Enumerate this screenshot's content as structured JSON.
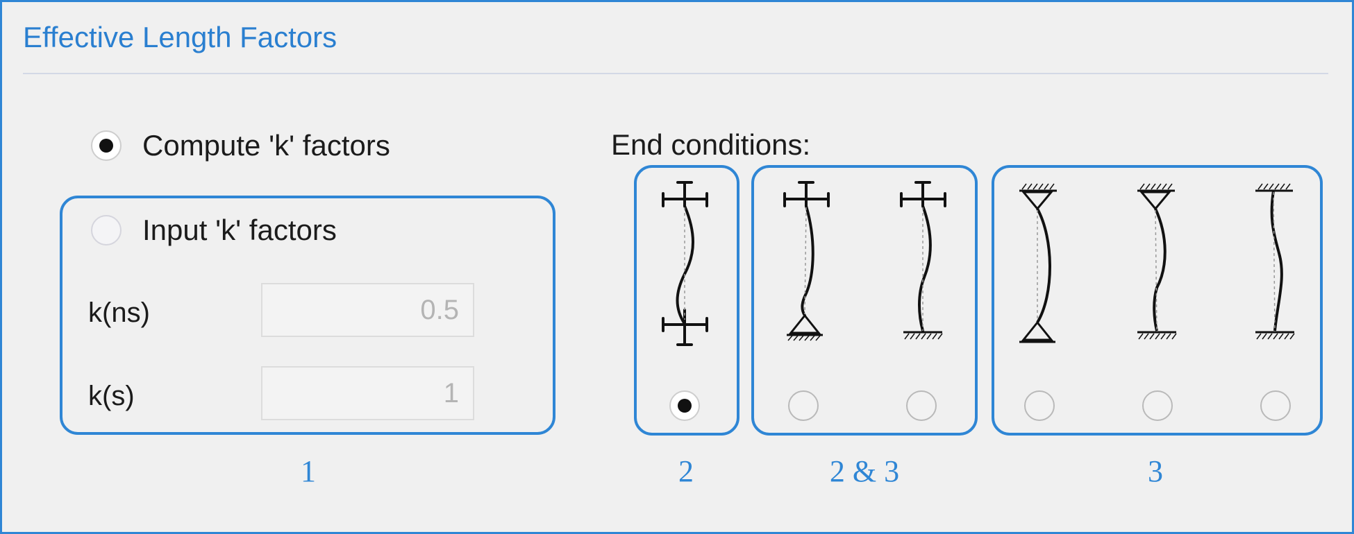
{
  "panel": {
    "title": "Effective Length Factors"
  },
  "k_mode": {
    "compute_label": "Compute 'k' factors",
    "compute_selected": true,
    "input_label": "Input 'k' factors",
    "input_selected": false
  },
  "fields": {
    "kns_label": "k(ns)",
    "kns_value": "0.5",
    "ks_label": "k(s)",
    "ks_value": "1"
  },
  "end_conditions": {
    "label": "End conditions:",
    "options": [
      {
        "top": "rotation-fixed translation-free",
        "bottom": "rotation-fixed translation-free",
        "selected": true
      },
      {
        "top": "rotation-fixed translation-free",
        "bottom": "pinned",
        "selected": false
      },
      {
        "top": "rotation-fixed translation-free",
        "bottom": "fixed",
        "selected": false
      },
      {
        "top": "pinned",
        "bottom": "pinned",
        "selected": false
      },
      {
        "top": "pinned",
        "bottom": "fixed",
        "selected": false
      },
      {
        "top": "fixed",
        "bottom": "fixed",
        "selected": false
      }
    ]
  },
  "annotations": {
    "callout_1": "1",
    "callout_2": "2",
    "callout_2_3": "2 & 3",
    "callout_3": "3"
  },
  "colors": {
    "accent": "#2f86d5",
    "title": "#2a7fd0"
  }
}
